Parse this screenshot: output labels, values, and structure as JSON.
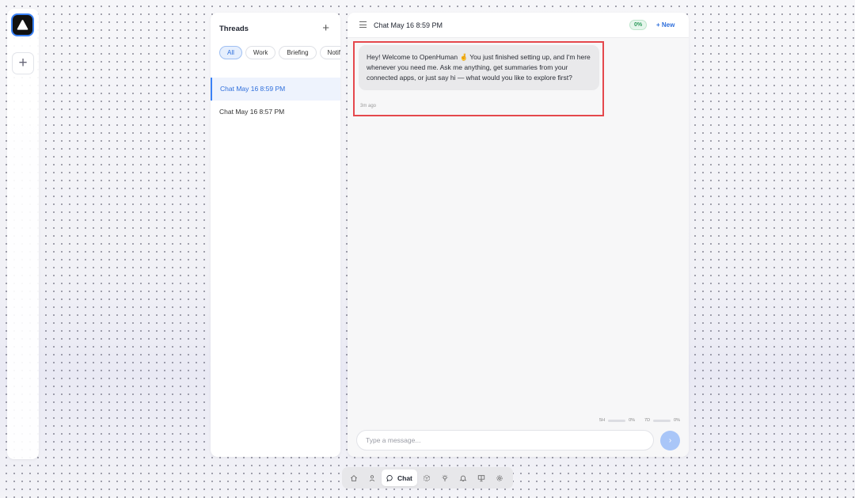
{
  "rail": {
    "add_label": "+"
  },
  "threads": {
    "title": "Threads",
    "add_label": "+",
    "filters": [
      {
        "label": "All",
        "active": true
      },
      {
        "label": "Work",
        "active": false
      },
      {
        "label": "Briefing",
        "active": false
      },
      {
        "label": "Notif",
        "active": false
      }
    ],
    "items": [
      {
        "label": "Chat May 16 8:59 PM",
        "selected": true
      },
      {
        "label": "Chat May 16 8:57 PM",
        "selected": false
      }
    ]
  },
  "chat": {
    "title": "Chat May 16 8:59 PM",
    "usage_badge": "0%",
    "new_label": "+ New",
    "message": {
      "text": "Hey! Welcome to OpenHuman 🤞 You just finished setting up, and I'm here whenever you need me. Ask me anything, get summaries from your connected apps, or just say hi — what would you like to explore first?",
      "time": "3m ago"
    },
    "usage": {
      "short_label": "5H",
      "short_value": "0%",
      "long_label": "7D",
      "long_value": "0%"
    },
    "input": {
      "placeholder": "Type a message...",
      "value": ""
    },
    "send_label": "›"
  },
  "bottom_nav": {
    "items": [
      {
        "name": "home-icon"
      },
      {
        "name": "person-icon"
      },
      {
        "name": "chat-icon",
        "label": "Chat",
        "active": true
      },
      {
        "name": "cube-icon"
      },
      {
        "name": "bulb-icon"
      },
      {
        "name": "bell-icon"
      },
      {
        "name": "presentation-icon"
      },
      {
        "name": "gear-icon"
      }
    ]
  },
  "colors": {
    "accent": "#3b82f6",
    "highlight": "#e5484d",
    "success": "#2c9a5a"
  }
}
